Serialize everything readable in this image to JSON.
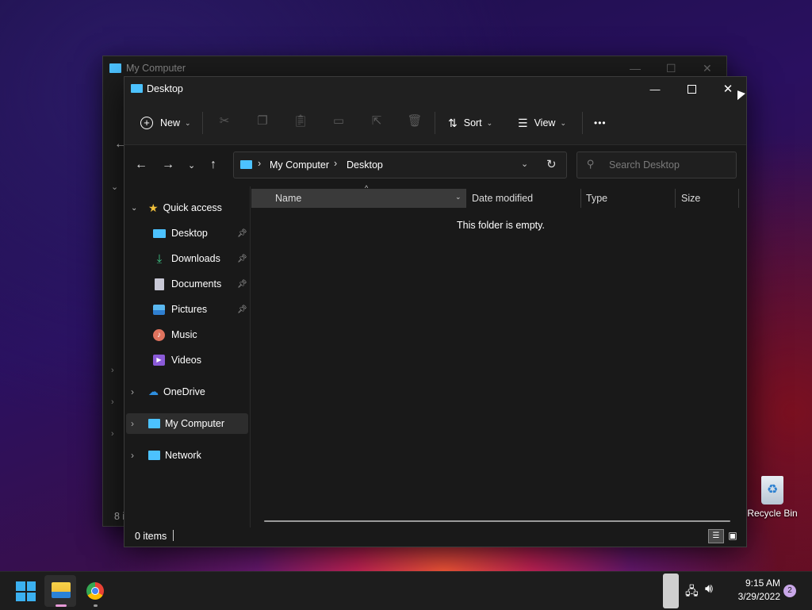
{
  "back_window": {
    "title": "My Computer",
    "status": "8 i"
  },
  "window": {
    "title": "Desktop",
    "toolbar": {
      "new_label": "New",
      "sort_label": "Sort",
      "view_label": "View",
      "more_label": "•••"
    },
    "breadcrumb": {
      "root": "My Computer",
      "current": "Desktop"
    },
    "search": {
      "placeholder": "Search Desktop"
    },
    "columns": [
      "Name",
      "Date modified",
      "Type",
      "Size"
    ],
    "empty_message": "This folder is empty.",
    "status": "0 items",
    "sidebar": {
      "quick_access": "Quick access",
      "quick_items": [
        {
          "label": "Desktop",
          "icon": "desktop-icon",
          "pinned": true
        },
        {
          "label": "Downloads",
          "icon": "download-icon",
          "pinned": true
        },
        {
          "label": "Documents",
          "icon": "document-icon",
          "pinned": true
        },
        {
          "label": "Pictures",
          "icon": "pictures-icon",
          "pinned": true
        },
        {
          "label": "Music",
          "icon": "music-icon",
          "pinned": false
        },
        {
          "label": "Videos",
          "icon": "videos-icon",
          "pinned": false
        }
      ],
      "onedrive": "OneDrive",
      "my_computer": "My Computer",
      "network": "Network"
    }
  },
  "desktop": {
    "recycle_bin": "Recycle Bin"
  },
  "taskbar": {
    "time": "9:15 AM",
    "date": "3/29/2022",
    "notifications": "2"
  },
  "colors": {
    "accent": "#4cc2ff",
    "folder": "#f2c13b",
    "selected": "#2d2d2d",
    "window_bg": "#191919"
  }
}
